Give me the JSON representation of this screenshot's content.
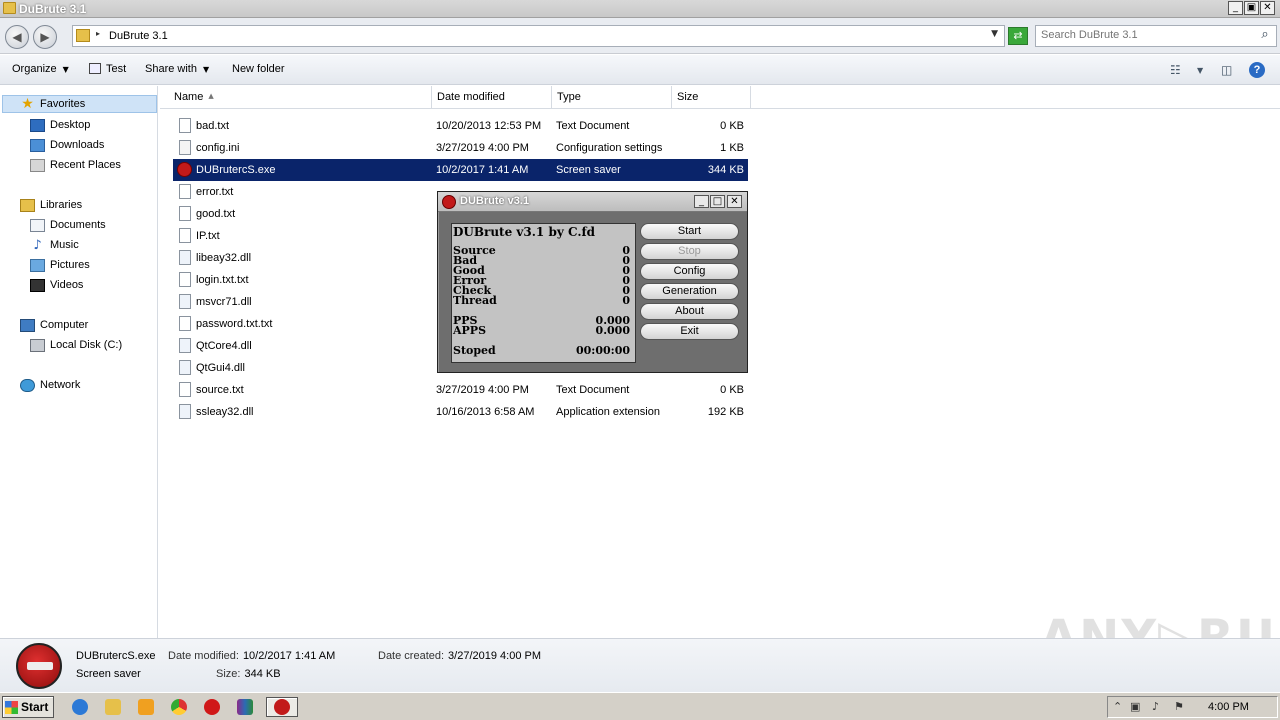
{
  "window": {
    "title": "DuBrute 3.1",
    "minimize": "_",
    "maximize": "▣",
    "close": "✕"
  },
  "address": {
    "path": "DuBrute 3.1",
    "search_placeholder": "Search DuBrute 3.1"
  },
  "toolbar": {
    "organize": "Organize",
    "test": "Test",
    "share_with": "Share with",
    "new_folder": "New folder"
  },
  "nav": {
    "favorites": "Favorites",
    "desktop": "Desktop",
    "downloads": "Downloads",
    "recent_places": "Recent Places",
    "libraries": "Libraries",
    "documents": "Documents",
    "music": "Music",
    "pictures": "Pictures",
    "videos": "Videos",
    "computer": "Computer",
    "local_disk": "Local Disk (C:)",
    "network": "Network"
  },
  "columns": {
    "name": "Name",
    "date_modified": "Date modified",
    "type": "Type",
    "size": "Size"
  },
  "files": [
    {
      "name": "bad.txt",
      "date": "10/20/2013 12:53 PM",
      "type": "Text Document",
      "size": "0 KB",
      "kind": "txt"
    },
    {
      "name": "config.ini",
      "date": "3/27/2019 4:00 PM",
      "type": "Configuration settings",
      "size": "1 KB",
      "kind": "ini"
    },
    {
      "name": "DUBrutercS.exe",
      "date": "10/2/2017 1:41 AM",
      "type": "Screen saver",
      "size": "344 KB",
      "kind": "exe"
    },
    {
      "name": "error.txt",
      "date": "",
      "type": "",
      "size": "",
      "kind": "txt"
    },
    {
      "name": "good.txt",
      "date": "",
      "type": "",
      "size": "",
      "kind": "txt"
    },
    {
      "name": "IP.txt",
      "date": "",
      "type": "",
      "size": "",
      "kind": "txt"
    },
    {
      "name": "libeay32.dll",
      "date": "",
      "type": "",
      "size": "",
      "kind": "dll"
    },
    {
      "name": "login.txt.txt",
      "date": "",
      "type": "",
      "size": "",
      "kind": "txt"
    },
    {
      "name": "msvcr71.dll",
      "date": "",
      "type": "",
      "size": "",
      "kind": "dll"
    },
    {
      "name": "password.txt.txt",
      "date": "",
      "type": "",
      "size": "",
      "kind": "txt"
    },
    {
      "name": "QtCore4.dll",
      "date": "",
      "type": "",
      "size": "",
      "kind": "dll"
    },
    {
      "name": "QtGui4.dll",
      "date": "",
      "type": "",
      "size": "",
      "kind": "dll"
    },
    {
      "name": "source.txt",
      "date": "3/27/2019 4:00 PM",
      "type": "Text Document",
      "size": "0 KB",
      "kind": "txt"
    },
    {
      "name": "ssleay32.dll",
      "date": "10/16/2013 6:58 AM",
      "type": "Application extension",
      "size": "192 KB",
      "kind": "dll"
    }
  ],
  "dubrute": {
    "title": "DUBrute v3.1",
    "heading": "DUBrute v3.1 by C.fd",
    "stats": [
      {
        "label": "Source",
        "value": "0"
      },
      {
        "label": "Bad",
        "value": "0"
      },
      {
        "label": "Good",
        "value": "0"
      },
      {
        "label": "Error",
        "value": "0"
      },
      {
        "label": "Check",
        "value": "0"
      },
      {
        "label": "Thread",
        "value": "0"
      }
    ],
    "pps_label": "PPS",
    "pps_value": "0.000",
    "apps_label": "APPS",
    "apps_value": "0.000",
    "status_label": "Stoped",
    "status_time": "00:00:00",
    "buttons": {
      "start": "Start",
      "stop": "Stop",
      "config": "Config",
      "generation": "Generation",
      "about": "About",
      "exit": "Exit"
    }
  },
  "details": {
    "filename": "DUBrutercS.exe",
    "type": "Screen saver",
    "date_modified_label": "Date modified:",
    "date_modified": "10/2/2017 1:41 AM",
    "date_created_label": "Date created:",
    "date_created": "3/27/2019 4:00 PM",
    "size_label": "Size:",
    "size": "344 KB"
  },
  "watermark": "ANY▷RUN",
  "taskbar": {
    "start": "Start",
    "clock": "4:00 PM"
  }
}
